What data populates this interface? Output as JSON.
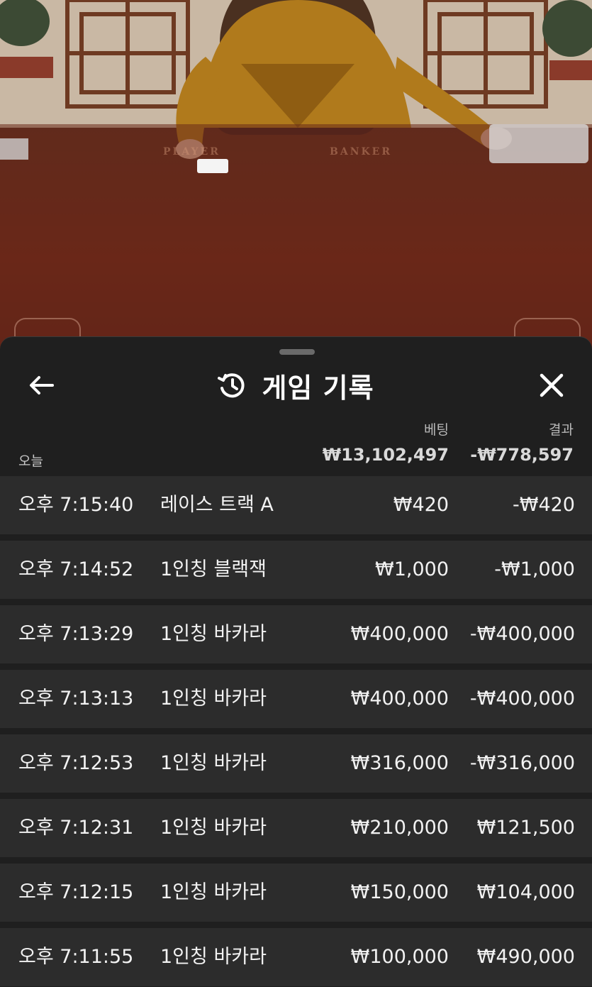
{
  "video": {
    "table_labels": [
      "PLAYER",
      "BANKER"
    ]
  },
  "sheet": {
    "title": "게임 기록",
    "icons": {
      "back": "arrow-left-icon",
      "history": "history-clock-icon",
      "close": "close-icon"
    },
    "columns": {
      "bet": "베팅",
      "result": "결과"
    },
    "summary": {
      "label": "오늘",
      "bet_total": "₩13,102,497",
      "result_total": "-₩778,597"
    },
    "rows": [
      {
        "time": "오후 7:15:40",
        "game": "레이스 트랙 A",
        "bet": "₩420",
        "result": "-₩420"
      },
      {
        "time": "오후 7:14:52",
        "game": "1인칭 블랙잭",
        "bet": "₩1,000",
        "result": "-₩1,000"
      },
      {
        "time": "오후 7:13:29",
        "game": "1인칭 바카라",
        "bet": "₩400,000",
        "result": "-₩400,000"
      },
      {
        "time": "오후 7:13:13",
        "game": "1인칭 바카라",
        "bet": "₩400,000",
        "result": "-₩400,000"
      },
      {
        "time": "오후 7:12:53",
        "game": "1인칭 바카라",
        "bet": "₩316,000",
        "result": "-₩316,000"
      },
      {
        "time": "오후 7:12:31",
        "game": "1인칭 바카라",
        "bet": "₩210,000",
        "result": "₩121,500"
      },
      {
        "time": "오후 7:12:15",
        "game": "1인칭 바카라",
        "bet": "₩150,000",
        "result": "₩104,000"
      },
      {
        "time": "오후 7:11:55",
        "game": "1인칭 바카라",
        "bet": "₩100,000",
        "result": "₩490,000"
      }
    ]
  }
}
